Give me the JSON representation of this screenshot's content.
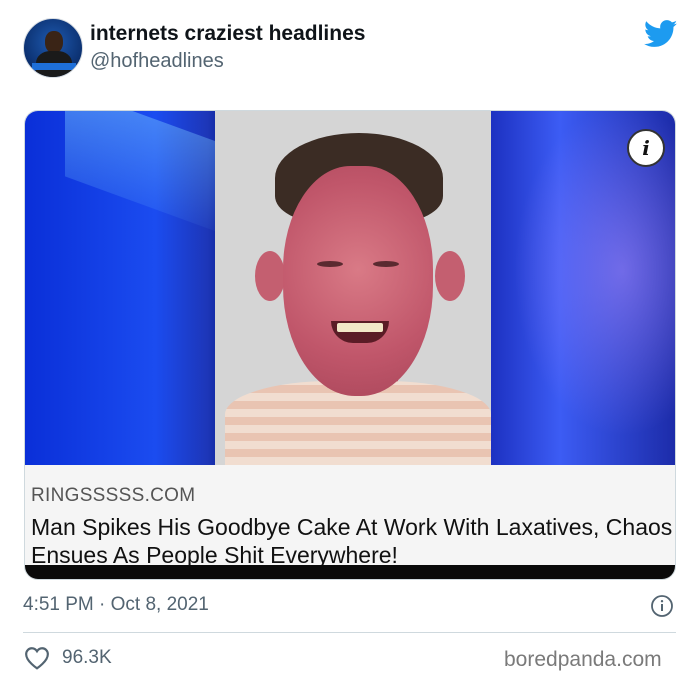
{
  "tweet": {
    "display_name": "internets craziest headlines",
    "handle": "@hofheadlines",
    "timestamp": "4:51 PM · Oct 8, 2021",
    "likes": "96.3K",
    "brand_color": "#1d9bf0"
  },
  "media": {
    "info_label": "i",
    "source": "RINGSSSSS.COM",
    "headline": "Man Spikes His Goodbye Cake At Work With Laxatives, Chaos Ensues As People Shit Everywhere!"
  },
  "watermark": "boredpanda.com",
  "icons": {
    "platform": "twitter-bird-icon",
    "info": "info-icon",
    "like": "heart-icon"
  }
}
